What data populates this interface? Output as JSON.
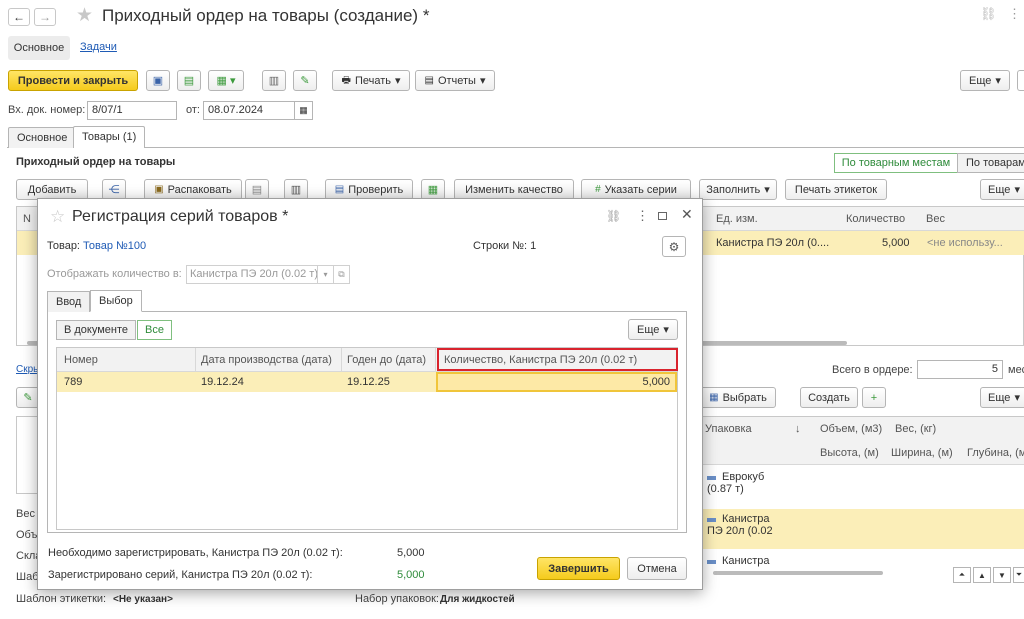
{
  "window": {
    "title": "Приходный ордер на товары (создание) *",
    "nav_tabs": [
      "Основное",
      "Задачи"
    ]
  },
  "toolbar": {
    "post_close": "Провести и закрыть",
    "print": "Печать",
    "reports": "Отчеты",
    "more": "Еще"
  },
  "header": {
    "in_doc_no_label": "Вх. док. номер:",
    "in_doc_no_value": "8/07/1",
    "date_label": "от:",
    "date_value": "08.07.2024"
  },
  "doc_tabs": [
    "Основное",
    "Товары (1)"
  ],
  "section": {
    "title": "Приходный ордер на товары",
    "by_places": "По товарным местам",
    "by_goods": "По товарам"
  },
  "goods_toolbar": {
    "add": "Добавить",
    "unpack": "Распаковать",
    "check": "Проверить",
    "change_quality": "Изменить качество",
    "set_series": "Указать серии",
    "fill": "Заполнить",
    "print_labels": "Печать этикеток",
    "more": "Еще"
  },
  "goods_table": {
    "col_n": "N",
    "col_unit": "Ед. изм.",
    "col_qty": "Количество",
    "col_weight": "Вес",
    "row_unit": "Канистра ПЭ 20л (0....",
    "row_qty": "5,000",
    "row_weight": "<не использу..."
  },
  "lower": {
    "hide_link": "Скры",
    "total_label": "Всего в ордере:",
    "total_value": "5",
    "total_unit": "мест",
    "select": "Выбрать",
    "create": "Создать",
    "more": "Еще",
    "col_pack": "Упаковка",
    "col_volume": "Объем, (м3)",
    "col_weight": "Вес, (кг)",
    "col_height": "Высота, (м)",
    "col_width": "Ширина, (м)",
    "col_depth": "Глубина, (м)",
    "packs": [
      "Еврокуб (0.87 т)",
      "Канистра ПЭ 20л (0.02",
      "Канистра"
    ],
    "side_labels": [
      "Вес",
      "Объ",
      "Скла",
      "Шаб"
    ]
  },
  "footer": {
    "label_template_label": "Шаблон этикетки:",
    "label_template_value": "<Не указан>",
    "packs_set_label": "Набор упаковок:",
    "packs_set_value": "Для жидкостей"
  },
  "dialog": {
    "title": "Регистрация серий товаров *",
    "product_label": "Товар:",
    "product_value": "Товар №100",
    "rows_label": "Строки №: 1",
    "show_qty_label": "Отображать количество в:",
    "show_qty_value": "Канистра ПЭ 20л (0.02 т)",
    "tabs": [
      "Ввод",
      "Выбор"
    ],
    "filter_in_doc": "В документе",
    "filter_all": "Все",
    "more": "Еще",
    "columns": [
      "Номер",
      "Дата производства (дата)",
      "Годен до (дата)",
      "Количество, Канистра ПЭ 20л (0.02 т)"
    ],
    "rows": [
      {
        "number": "789",
        "prod_date": "19.12.24",
        "exp_date": "19.12.25",
        "qty": "5,000"
      }
    ],
    "need_register_label": "Необходимо зарегистрировать, Канистра ПЭ 20л (0.02 т):",
    "need_register_value": "5,000",
    "registered_label": "Зарегистрировано серий, Канистра ПЭ 20л (0.02 т):",
    "registered_value": "5,000",
    "finish": "Завершить",
    "cancel": "Отмена"
  },
  "colors": {
    "accent_yellow": "#f5cb1c",
    "row_highlight": "#fbeeb8",
    "link_blue": "#1f5bb5",
    "green": "#2e8b3a",
    "red_box": "#d9232d"
  }
}
